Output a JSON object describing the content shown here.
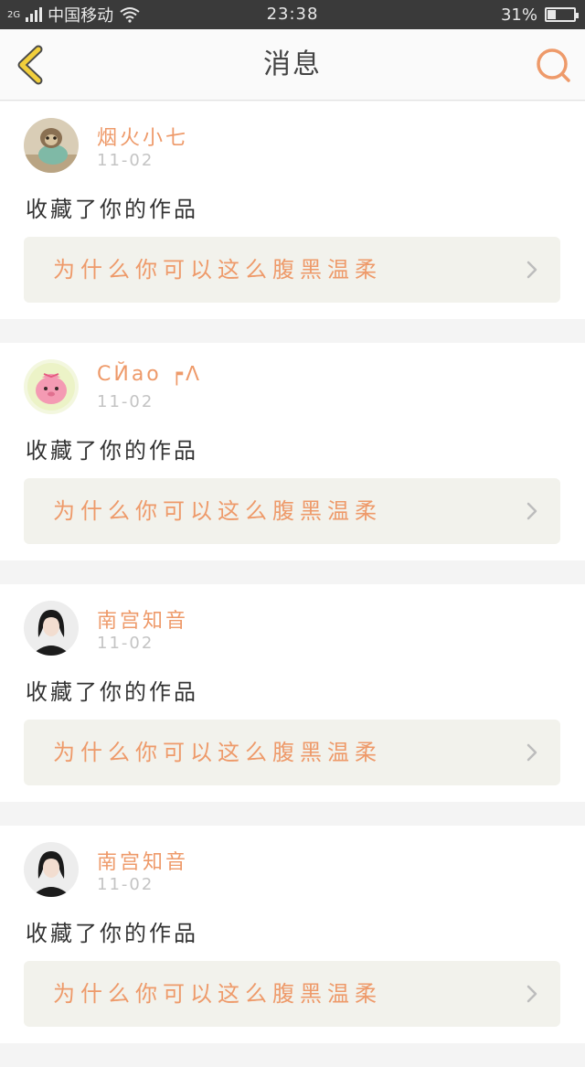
{
  "status_bar": {
    "network": "2G",
    "carrier": "中国移动",
    "time": "23:38",
    "battery_text": "31%",
    "battery_level": 0.31
  },
  "header": {
    "title": "消息",
    "back_icon": "chevron-left-icon",
    "search_icon": "search-icon"
  },
  "colors": {
    "accent": "#ee9a6a",
    "back_icon": "#f2cf3c",
    "status_bar": "#3a3a3a",
    "card_link_bg": "#f2f2ec"
  },
  "messages": [
    {
      "user": "烟火小七",
      "date": "11-02",
      "action": "收藏了你的作品",
      "work_title": "为什么你可以这么腹黑温柔",
      "avatar": "sloth-avatar"
    },
    {
      "user": "CЙao ┍ᐱ",
      "date": "11-02",
      "action": "收藏了你的作品",
      "work_title": "为什么你可以这么腹黑温柔",
      "avatar": "pink-creature-avatar"
    },
    {
      "user": "南宫知音",
      "date": "11-02",
      "action": "收藏了你的作品",
      "work_title": "为什么你可以这么腹黑温柔",
      "avatar": "girl-avatar"
    },
    {
      "user": "南宫知音",
      "date": "11-02",
      "action": "收藏了你的作品",
      "work_title": "为什么你可以这么腹黑温柔",
      "avatar": "girl-avatar"
    }
  ]
}
